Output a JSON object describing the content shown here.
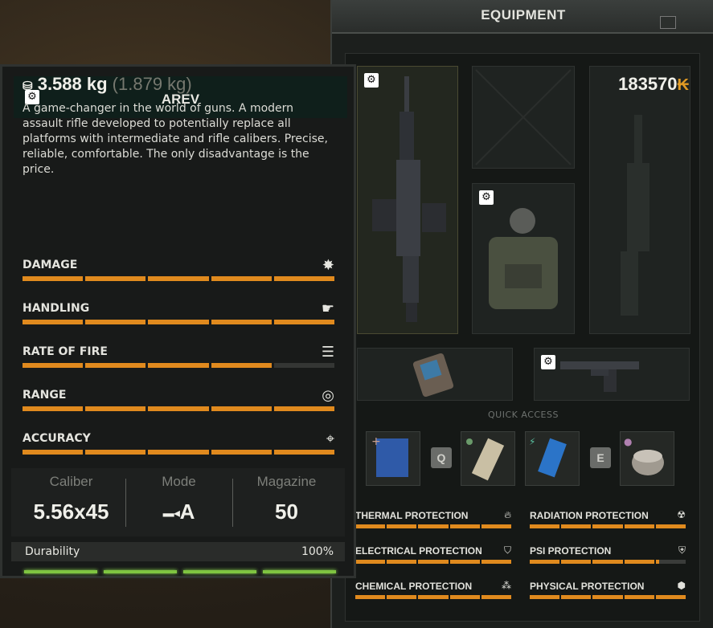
{
  "equipment": {
    "title": "EQUIPMENT",
    "quick_access_label": "QUICK ACCESS",
    "hotkeys": [
      "Q",
      "E"
    ],
    "protections": [
      {
        "label": "THERMAL PROTECTION",
        "icon": "flame-icon",
        "fill": 1.0
      },
      {
        "label": "RADIATION PROTECTION",
        "icon": "radiation-icon",
        "fill": 1.0
      },
      {
        "label": "ELECTRICAL PROTECTION",
        "icon": "shield-bolt-icon",
        "fill": 1.0
      },
      {
        "label": "PSI PROTECTION",
        "icon": "psi-shield-icon",
        "fill": 0.82
      },
      {
        "label": "CHEMICAL PROTECTION",
        "icon": "chemical-icon",
        "fill": 1.0
      },
      {
        "label": "PHYSICAL PROTECTION",
        "icon": "armor-icon",
        "fill": 1.0
      }
    ]
  },
  "item": {
    "name": "AREV",
    "weight": "3.588 kg",
    "weight_extra": "(1.879 kg)",
    "price": "183570",
    "price_symbol": "₭",
    "description": "A game-changer in the world of guns. A modern assault rifle developed to potentially replace all platforms with intermediate and rifle calibers. Precise, reliable, comfortable. The only disadvantage is the price.",
    "stats": [
      {
        "label": "DAMAGE",
        "icon": "explosion-icon",
        "value": 1.0
      },
      {
        "label": "HANDLING",
        "icon": "hand-gun-icon",
        "value": 1.0
      },
      {
        "label": "RATE OF FIRE",
        "icon": "bullets-icon",
        "value": 0.8
      },
      {
        "label": "RANGE",
        "icon": "radar-icon",
        "value": 1.0
      },
      {
        "label": "ACCURACY",
        "icon": "crosshair-icon",
        "value": 1.0
      }
    ],
    "specs": {
      "caliber_label": "Caliber",
      "caliber_value": "5.56x45",
      "mode_label": "Mode",
      "mode_value": "A",
      "magazine_label": "Magazine",
      "magazine_value": "50"
    },
    "durability_label": "Durability",
    "durability_value": "100%",
    "colors": {
      "accent": "#e08a1e",
      "durability": "#7fc441",
      "header": "#0f1f1b"
    }
  }
}
